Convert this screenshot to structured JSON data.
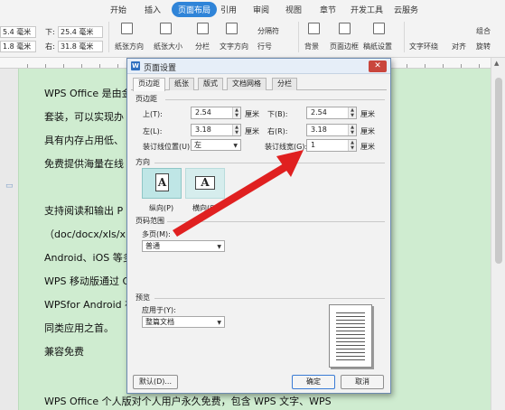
{
  "ribbon": {
    "tabs": [
      "开始",
      "插入",
      "页面布局",
      "引用",
      "审阅",
      "视图",
      "章节",
      "开发工具",
      "云服务"
    ],
    "active_tab": "页面布局",
    "fields": {
      "top_value": "5.4 毫米",
      "bottom_label": "下:",
      "bottom_value": "25.4 毫米",
      "left_value": "1.8 毫米",
      "right_label": "右:",
      "right_value": "31.8 毫米"
    },
    "buttons": {
      "orientation": "纸张方向",
      "size": "纸张大小",
      "columns": "分栏",
      "text_direction": "文字方向",
      "breaks": "分隔符",
      "line_numbers": "行号",
      "background": "背景",
      "page_border": "页面边框",
      "draft_paper": "稿纸设置",
      "wrap": "文字环绕",
      "align": "对齐",
      "group": "组合",
      "rotate": "旋转"
    }
  },
  "document": {
    "lines": [
      "WPS Office 是由金",
      "套装，可以实现办",
      "具有内存占用低、",
      "免费提供海量在线",
      "支持阅读和输出 P",
      "（doc/docx/xls/xlsx",
      "Android、iOS 等多",
      "WPS 移动版通过 G",
      "WPSfor Android 在",
      "同类应用之首。",
      "兼容免费",
      "WPS Office 个人版对个人用户永久免费，包含  WPS 文字、WPS"
    ]
  },
  "dialog": {
    "title": "页面设置",
    "close_label": "✕",
    "tabs": [
      "页边距",
      "纸张",
      "版式",
      "文档网格",
      "分栏"
    ],
    "active_tab": "页边距",
    "margins_section": "页边距",
    "top_label": "上(T):",
    "top_value": "2.54",
    "bottom_label": "下(B):",
    "bottom_value": "2.54",
    "left_label": "左(L):",
    "left_value": "3.18",
    "right_label": "右(R):",
    "right_value": "3.18",
    "unit": "厘米",
    "gutter_pos_label": "装订线位置(U):",
    "gutter_pos_value": "左",
    "gutter_width_label": "装订线宽(G):",
    "gutter_width_value": "1",
    "orientation_section": "方向",
    "portrait_label": "纵向(P)",
    "landscape_label": "横向(S)",
    "page_range_section": "页码范围",
    "multi_page_label": "多页(M):",
    "multi_page_value": "普通",
    "preview_section": "预览",
    "apply_to_label": "应用于(Y):",
    "apply_to_value": "整篇文档",
    "default_button": "默认(D)...",
    "ok_button": "确定",
    "cancel_button": "取消"
  },
  "colors": {
    "accent": "#2f84d8",
    "page_background": "#cfecd0",
    "annotation_arrow": "#e02020"
  }
}
